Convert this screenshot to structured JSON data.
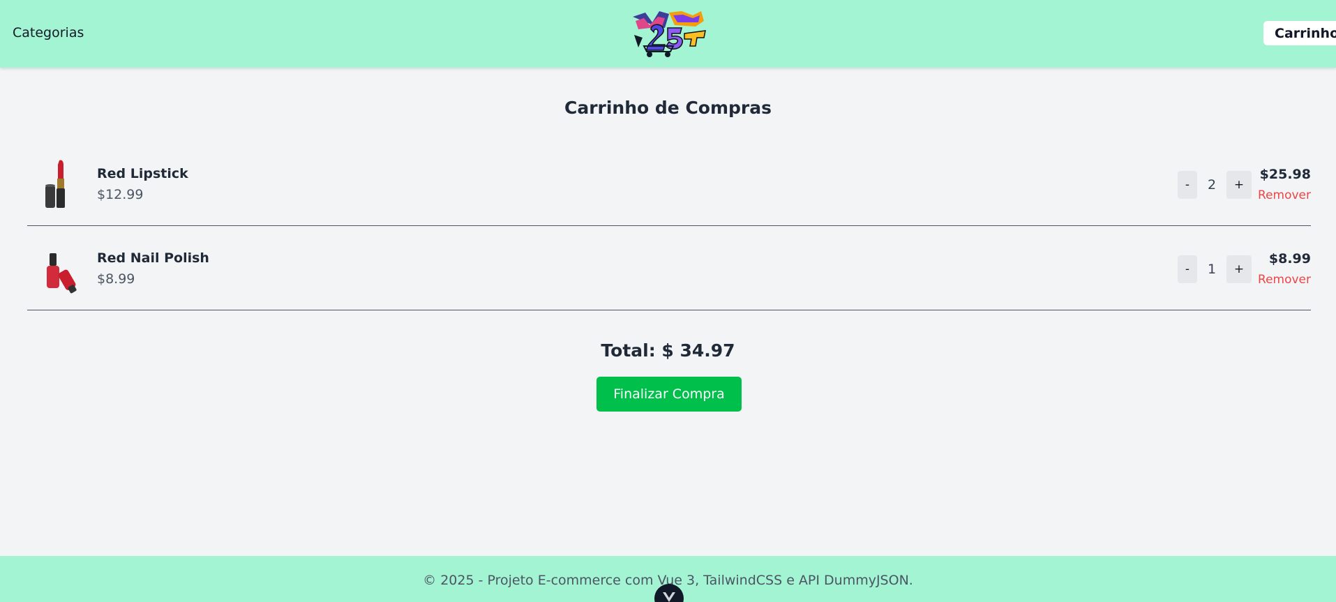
{
  "header": {
    "categories_label": "Categorias",
    "logo_text": "MARCH 25TH",
    "cart_label": "Carrinho"
  },
  "main": {
    "title": "Carrinho de Compras",
    "items": [
      {
        "name": "Red Lipstick",
        "unit_price": "$12.99",
        "quantity": "2",
        "line_total": "$25.98",
        "minus_label": "-",
        "plus_label": "+",
        "remove_label": "Remover",
        "icon": "lipstick-icon"
      },
      {
        "name": "Red Nail Polish",
        "unit_price": "$8.99",
        "quantity": "1",
        "line_total": "$8.99",
        "minus_label": "-",
        "plus_label": "+",
        "remove_label": "Remover",
        "icon": "nail-polish-icon"
      }
    ],
    "total_text": "Total: $ 34.97",
    "checkout_label": "Finalizar Compra"
  },
  "footer": {
    "text": "© 2025 - Projeto E-commerce com Vue 3, TailwindCSS e API DummyJSON."
  },
  "colors": {
    "header_bg": "#a3f4d2",
    "page_bg": "#f3f4f6",
    "checkout_bg": "#00c04b",
    "remove_text": "#ef4444"
  }
}
